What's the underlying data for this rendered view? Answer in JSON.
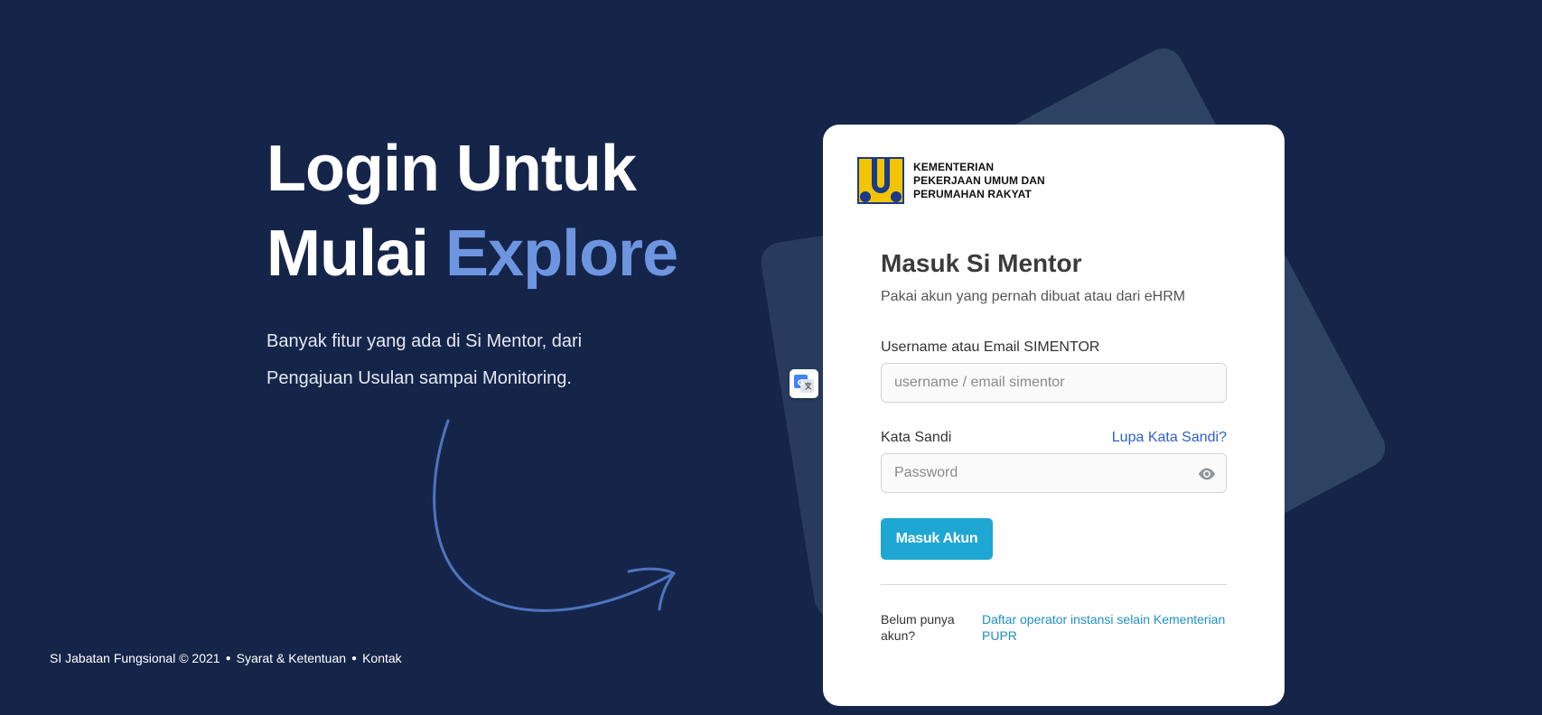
{
  "hero": {
    "title_line1": "Login Untuk",
    "title_line2_plain": "Mulai ",
    "title_line2_accent": "Explore",
    "desc_line1": "Banyak fitur yang ada di Si Mentor, dari",
    "desc_line2": "Pengajuan Usulan sampai Monitoring."
  },
  "footer": {
    "copyright": "SI Jabatan Fungsional © 2021",
    "sep": "●",
    "terms": "Syarat & Ketentuan",
    "contact": "Kontak"
  },
  "logo": {
    "line1": "KEMENTERIAN",
    "line2": "PEKERJAAN UMUM DAN",
    "line3": "PERUMAHAN RAKYAT"
  },
  "form": {
    "title": "Masuk Si Mentor",
    "subtitle": "Pakai akun yang pernah dibuat atau dari eHRM",
    "username_label": "Username atau Email SIMENTOR",
    "username_placeholder": "username / email simentor",
    "username_value": "",
    "password_label": "Kata Sandi",
    "forgot_label": "Lupa Kata Sandi?",
    "password_placeholder": "Password",
    "password_value": "",
    "submit_label": "Masuk Akun",
    "register_question": "Belum punya akun?",
    "register_link": "Daftar operator instansi selain Kementerian PUPR"
  },
  "colors": {
    "background": "#15254a",
    "accent_text": "#6d95e0",
    "button": "#1ea7d2",
    "link": "#2f5fd0",
    "logo_yellow": "#f2c500",
    "logo_blue": "#1b3a8a"
  },
  "icons": {
    "translate": "google-translate-icon",
    "password_toggle": "eye-icon",
    "logo": "pupr-logo-icon",
    "arrow": "curved-arrow-icon"
  }
}
